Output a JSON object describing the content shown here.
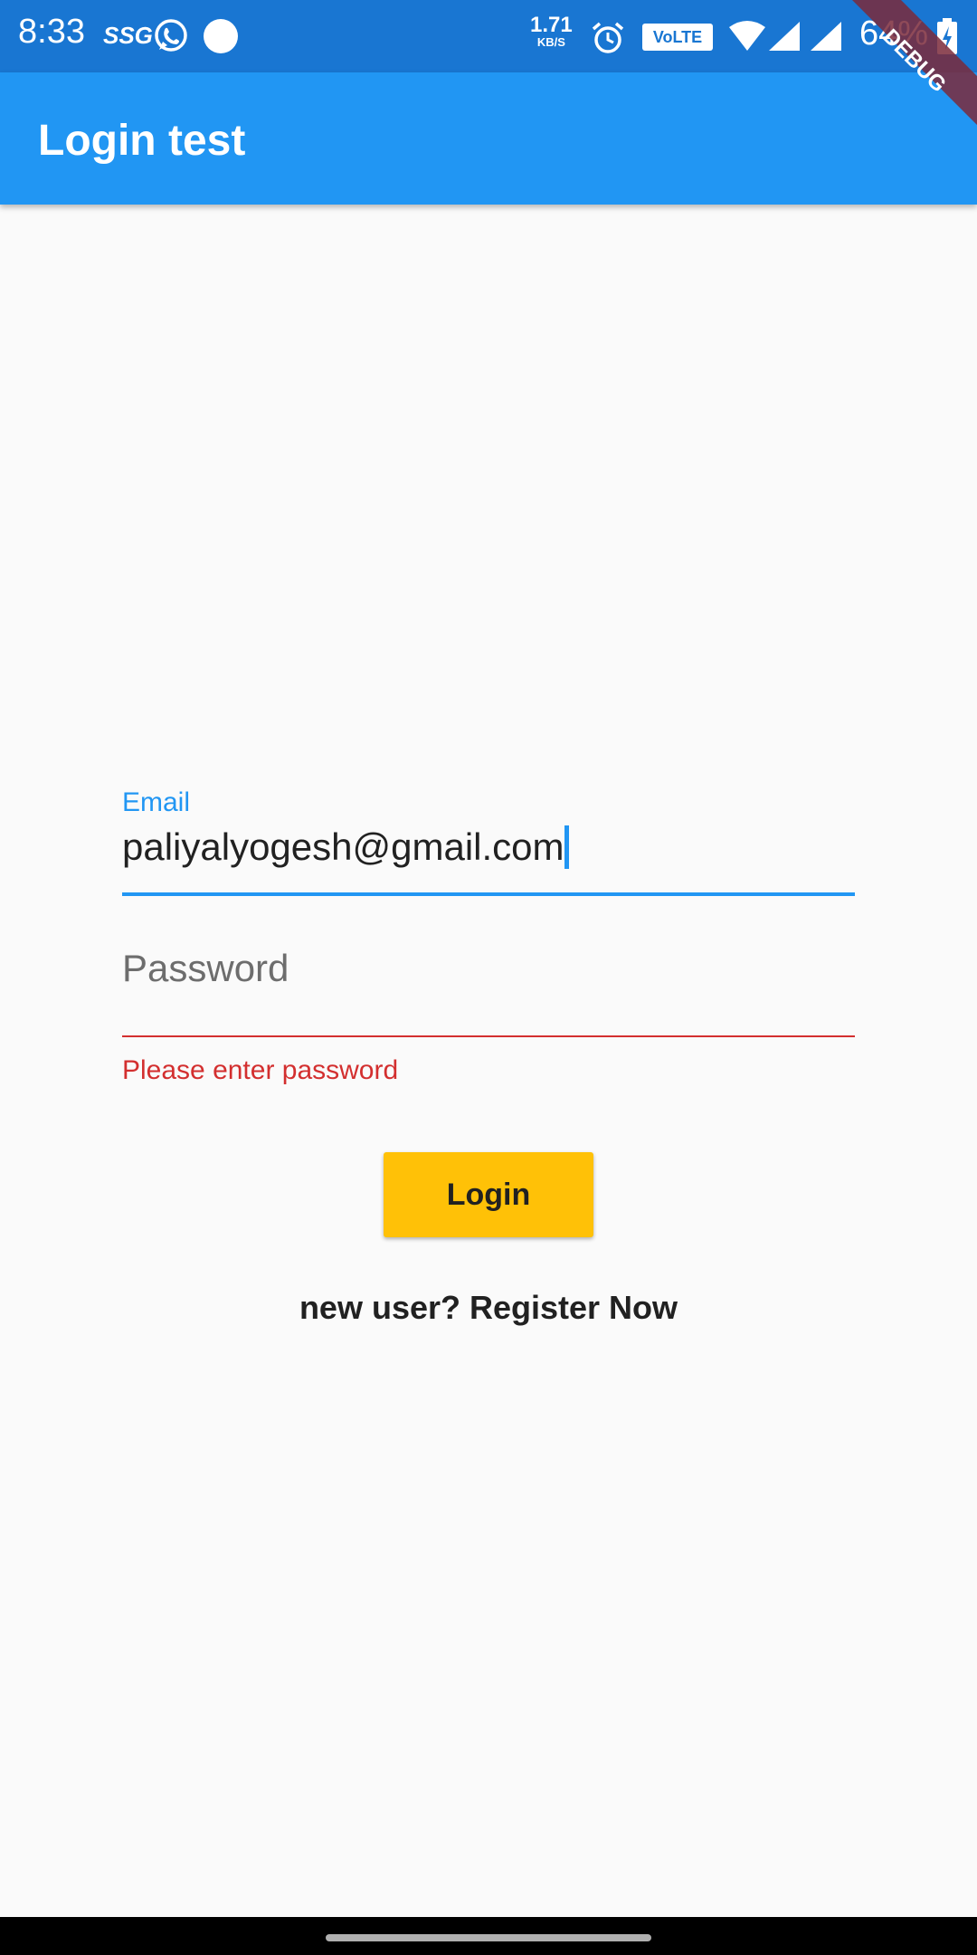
{
  "status_bar": {
    "time": "8:33",
    "carrier_label": "SSG",
    "net_speed_value": "1.71",
    "net_speed_unit": "KB/S",
    "volte_label": "VoLTE",
    "battery_percent": "64%",
    "icons": [
      "whatsapp-icon",
      "notification-dot-icon",
      "alarm-icon",
      "wifi-icon",
      "signal-icon",
      "signal-icon-2",
      "battery-charging-icon"
    ]
  },
  "app_bar": {
    "title": "Login test"
  },
  "debug_banner": "DEBUG",
  "form": {
    "email": {
      "label": "Email",
      "value": "paliyalyogesh@gmail.com"
    },
    "password": {
      "placeholder": "Password",
      "error": "Please enter password"
    },
    "login_button": "Login",
    "register_link": "new user? Register Now"
  },
  "colors": {
    "primary": "#2196f3",
    "status_bar": "#1976d2",
    "error": "#d32f2f",
    "button": "#ffc107",
    "debug_ribbon": "#7b2a3b"
  }
}
